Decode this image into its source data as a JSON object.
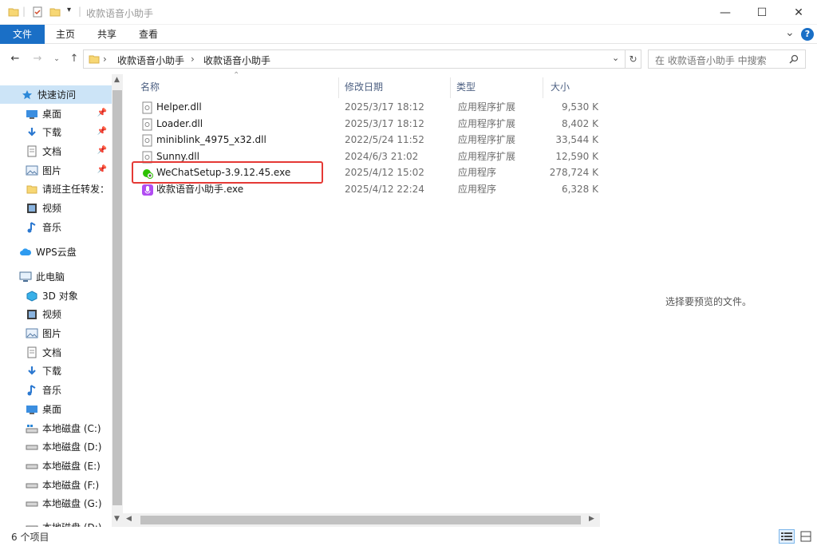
{
  "window": {
    "title": "收款语音小助手",
    "minimize": "—",
    "maximize": "☐",
    "close": "✕"
  },
  "ribbon": {
    "tabs": [
      "文件",
      "主页",
      "共享",
      "查看"
    ],
    "collapse": "⌄",
    "help": "?"
  },
  "address": {
    "crumbs": [
      "收款语音小助手",
      "收款语音小助手"
    ],
    "search_placeholder": "在 收款语音小助手 中搜索"
  },
  "sidebar": {
    "quick_access": "快速访问",
    "quick_items": [
      {
        "label": "桌面",
        "icon": "desktop-icon",
        "pinned": true
      },
      {
        "label": "下载",
        "icon": "download-icon",
        "pinned": true
      },
      {
        "label": "文档",
        "icon": "document-icon",
        "pinned": true
      },
      {
        "label": "图片",
        "icon": "picture-icon",
        "pinned": true
      },
      {
        "label": "请班主任转发：",
        "icon": "folder-icon",
        "pinned": false
      },
      {
        "label": "视频",
        "icon": "video-icon",
        "pinned": false
      },
      {
        "label": "音乐",
        "icon": "music-icon",
        "pinned": false
      }
    ],
    "wps": "WPS云盘",
    "this_pc": "此电脑",
    "pc_items": [
      {
        "label": "3D 对象",
        "icon": "3d-objects-icon"
      },
      {
        "label": "视频",
        "icon": "video-icon"
      },
      {
        "label": "图片",
        "icon": "picture-icon"
      },
      {
        "label": "文档",
        "icon": "document-icon"
      },
      {
        "label": "下载",
        "icon": "download-icon"
      },
      {
        "label": "音乐",
        "icon": "music-icon"
      },
      {
        "label": "桌面",
        "icon": "desktop-icon"
      },
      {
        "label": "本地磁盘 (C:)",
        "icon": "system-drive-icon"
      },
      {
        "label": "本地磁盘 (D:)",
        "icon": "drive-icon"
      },
      {
        "label": "本地磁盘 (E:)",
        "icon": "drive-icon"
      },
      {
        "label": "本地磁盘 (F:)",
        "icon": "drive-icon"
      },
      {
        "label": "本地磁盘 (G:)",
        "icon": "drive-icon"
      },
      {
        "label": "本地磁盘 (D:)",
        "icon": "drive-icon"
      }
    ]
  },
  "list": {
    "headers": {
      "name": "名称",
      "date": "修改日期",
      "type": "类型",
      "size": "大小"
    },
    "files": [
      {
        "name": "Helper.dll",
        "date": "2025/3/17 18:12",
        "type": "应用程序扩展",
        "size": "9,530 K",
        "icon": "dll-file-icon"
      },
      {
        "name": "Loader.dll",
        "date": "2025/3/17 18:12",
        "type": "应用程序扩展",
        "size": "8,402 K",
        "icon": "dll-file-icon"
      },
      {
        "name": "miniblink_4975_x32.dll",
        "date": "2022/5/24 11:52",
        "type": "应用程序扩展",
        "size": "33,544 K",
        "icon": "dll-file-icon"
      },
      {
        "name": "Sunny.dll",
        "date": "2024/6/3 21:02",
        "type": "应用程序扩展",
        "size": "12,590 K",
        "icon": "dll-file-icon"
      },
      {
        "name": "WeChatSetup-3.9.12.45.exe",
        "date": "2025/4/12 15:02",
        "type": "应用程序",
        "size": "278,724 K",
        "icon": "wechat-icon"
      },
      {
        "name": "收款语音小助手.exe",
        "date": "2025/4/12 22:24",
        "type": "应用程序",
        "size": "6,328 K",
        "icon": "voice-app-icon"
      }
    ]
  },
  "preview": {
    "text": "选择要预览的文件。"
  },
  "status": {
    "count": "6 个项目"
  },
  "colors": {
    "accent": "#1a6fc6",
    "selection": "#cce4f7",
    "highlight_border": "#e53935"
  }
}
